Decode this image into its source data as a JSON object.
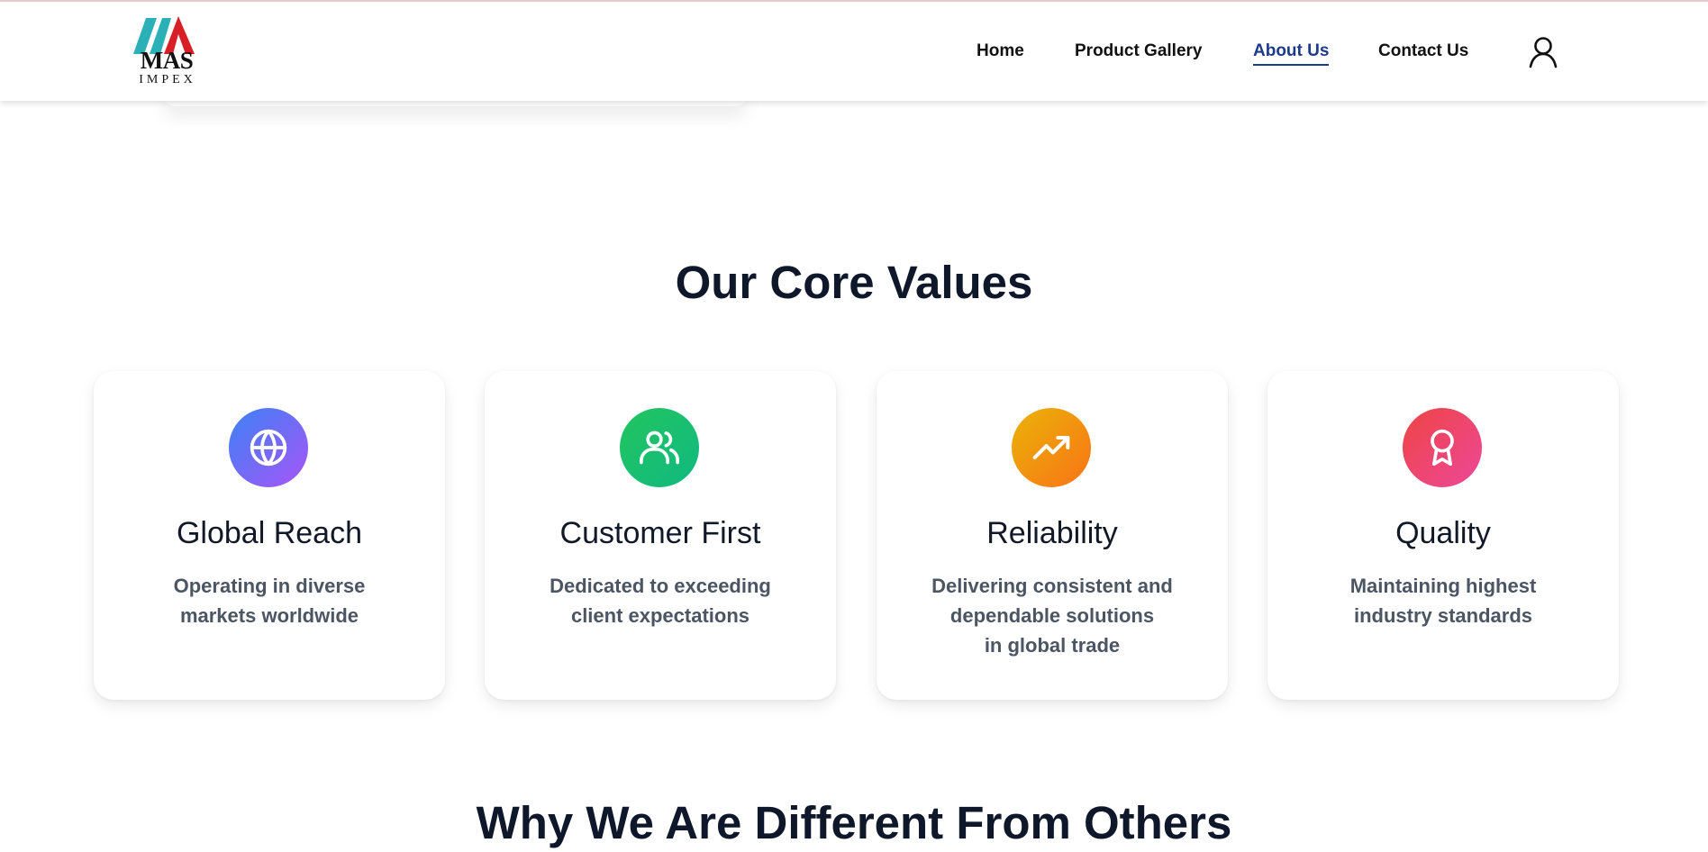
{
  "brand": {
    "name": "MAS",
    "sub": "IMPEX",
    "colors": {
      "teal": "#2bb0b8",
      "red": "#d81f26"
    }
  },
  "nav": {
    "items": [
      {
        "label": "Home",
        "active": false
      },
      {
        "label": "Product Gallery",
        "active": false
      },
      {
        "label": "About Us",
        "active": true
      },
      {
        "label": "Contact Us",
        "active": false
      }
    ],
    "account_icon": "user-icon",
    "active_color": "#1e3a8a"
  },
  "core_values": {
    "title": "Our Core Values",
    "cards": [
      {
        "icon": "globe-icon",
        "title": "Global Reach",
        "description": "Operating in diverse\nmarkets worldwide",
        "gradient": [
          "#3b82f6",
          "#a855f7"
        ]
      },
      {
        "icon": "users-icon",
        "title": "Customer First",
        "description": "Dedicated to exceeding\nclient expectations",
        "gradient": [
          "#22c55e",
          "#10b981"
        ]
      },
      {
        "icon": "trending-up-icon",
        "title": "Reliability",
        "description": "Delivering consistent and\ndependable solutions\nin global trade",
        "gradient": [
          "#eab308",
          "#f97316"
        ]
      },
      {
        "icon": "award-icon",
        "title": "Quality",
        "description": "Maintaining highest\nindustry standards",
        "gradient": [
          "#ef4444",
          "#ec4899"
        ]
      }
    ]
  },
  "next_section": {
    "title": "Why We Are Different From Others"
  }
}
